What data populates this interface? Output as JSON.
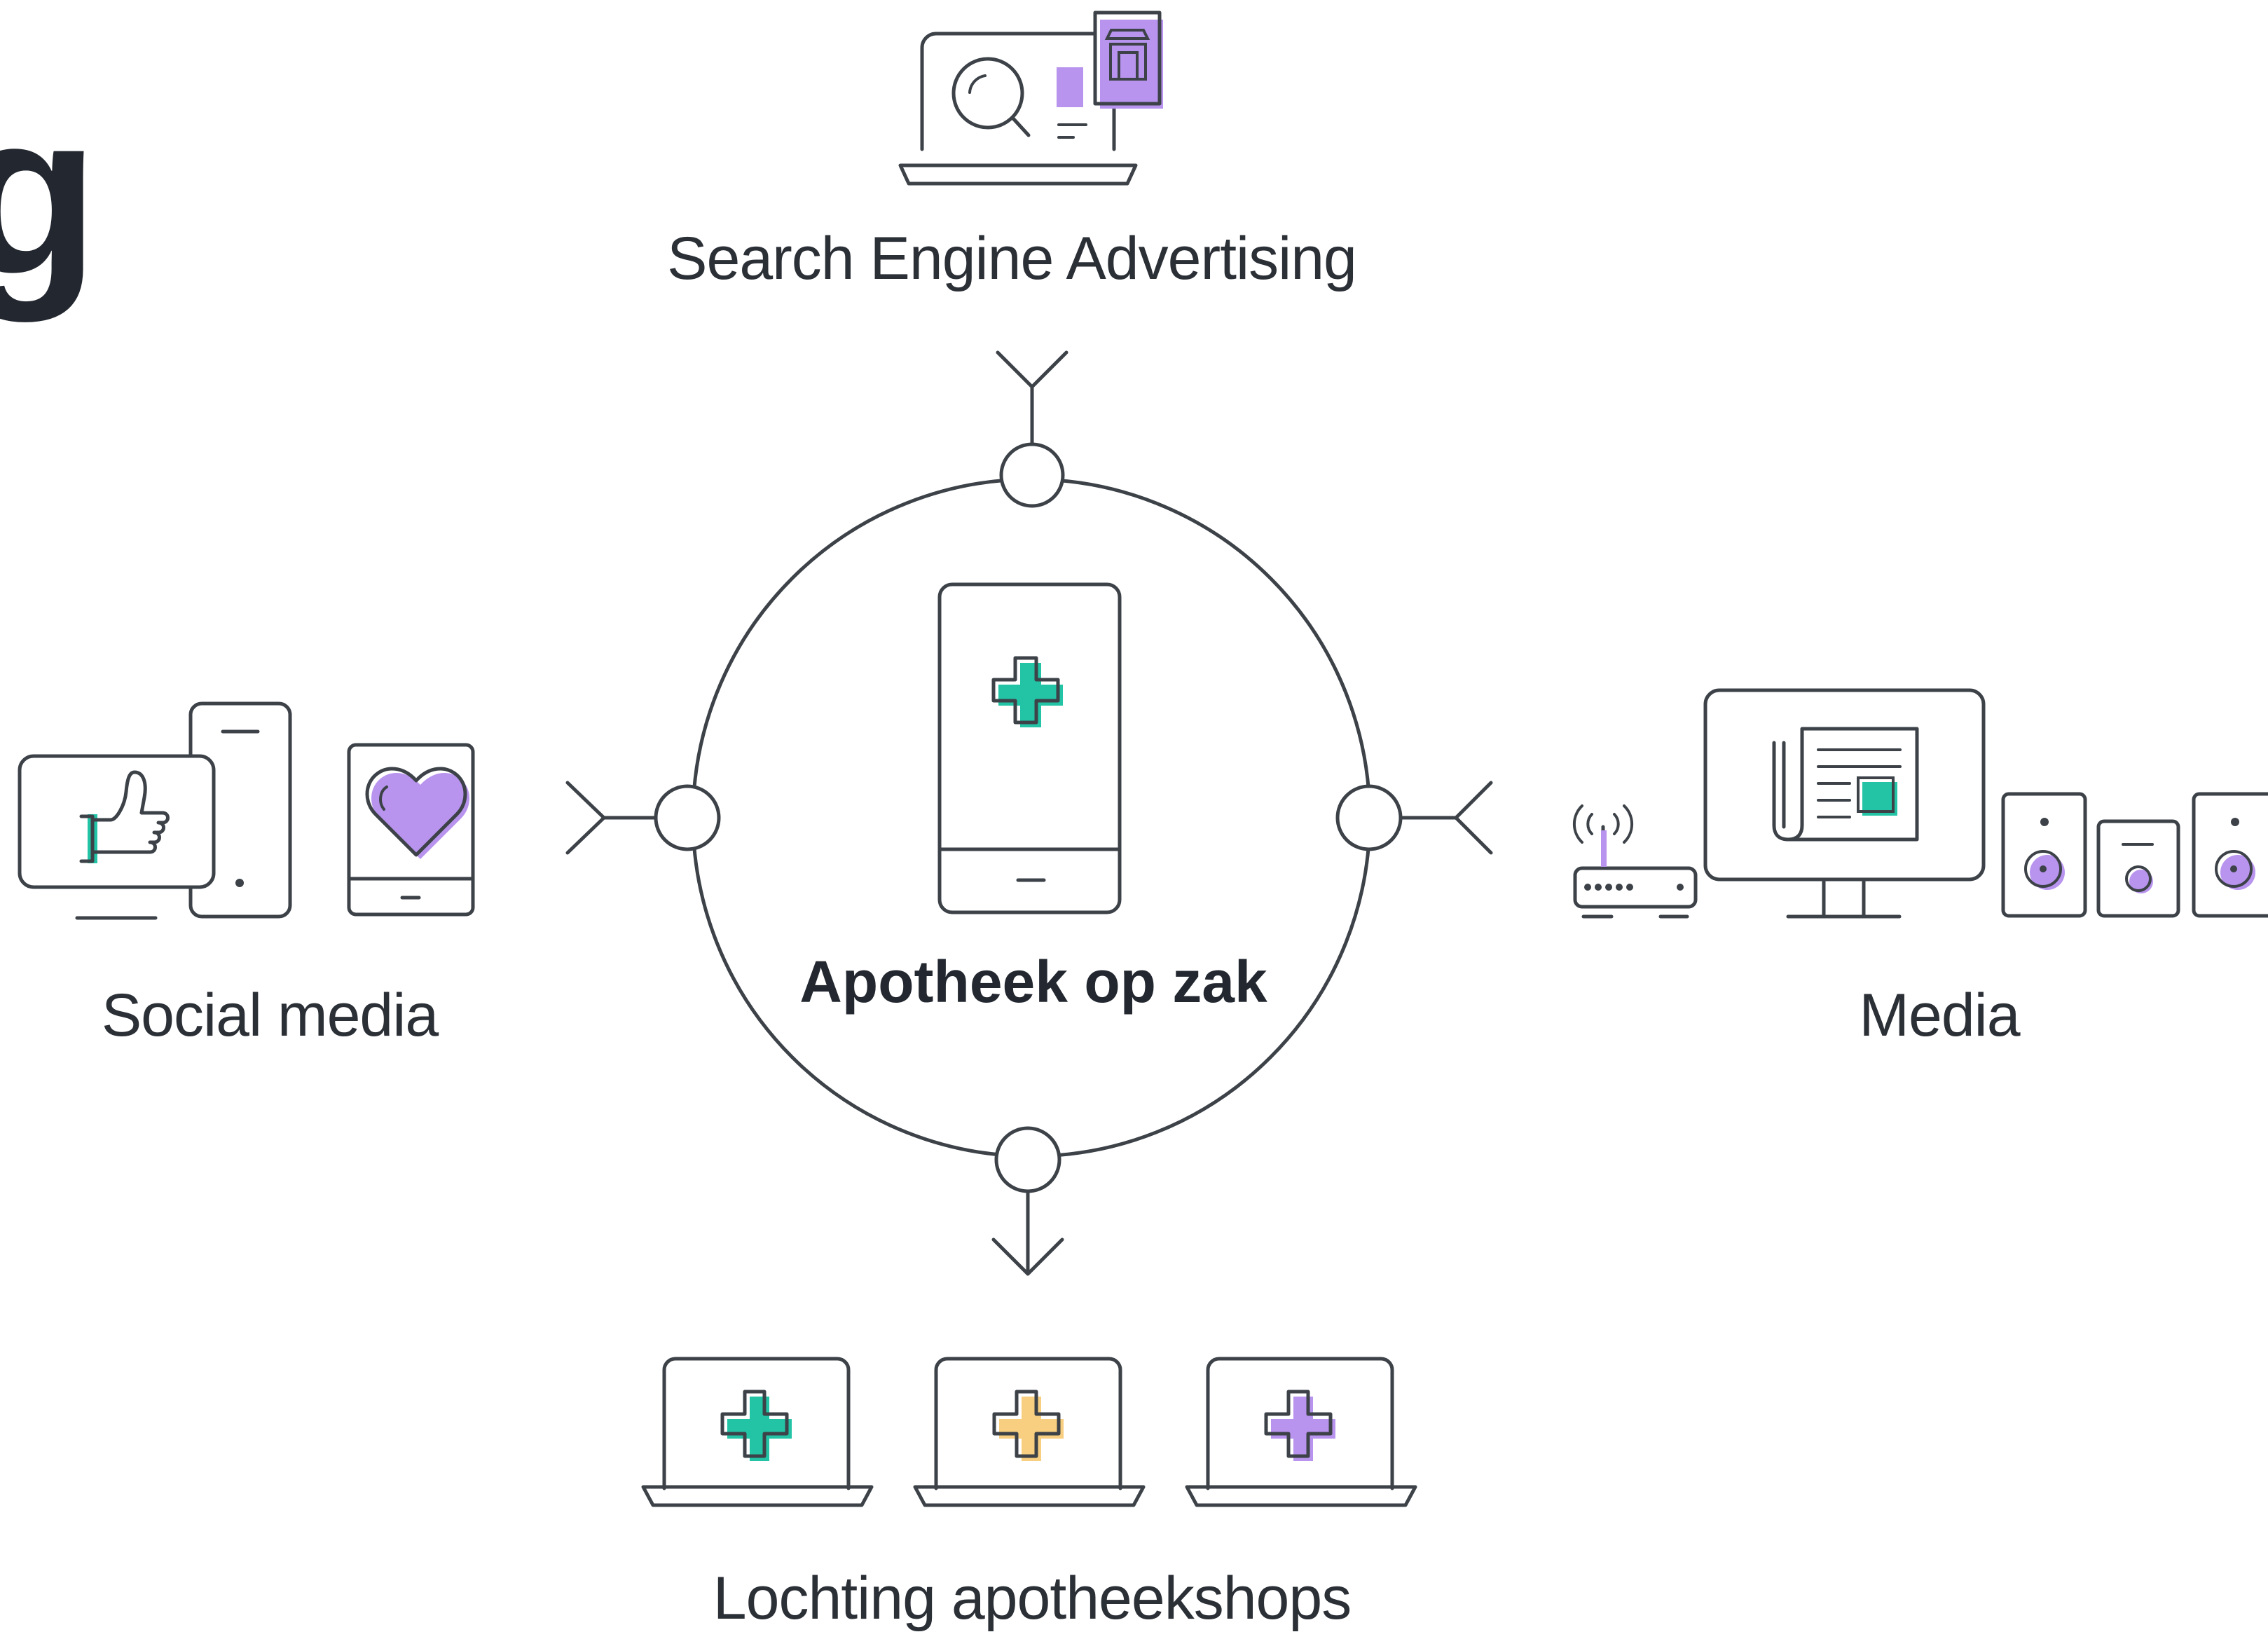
{
  "heading_fragment": "g",
  "center": {
    "label": "Apotheek op zak"
  },
  "channels": {
    "top": {
      "label": "Search Engine Advertising",
      "icon": "laptop-search-store-icon"
    },
    "left": {
      "label": "Social media",
      "icon": "social-devices-icon"
    },
    "right": {
      "label": "Media",
      "icon": "media-devices-icon"
    },
    "bottom": {
      "label": "Lochting apotheekshops",
      "icon": "laptops-pharmacy-icon"
    }
  },
  "colors": {
    "line": "#3c4248",
    "teal": "#23c4a6",
    "purple": "#b894ee",
    "yellow": "#f8cf80",
    "text": "#232830"
  }
}
